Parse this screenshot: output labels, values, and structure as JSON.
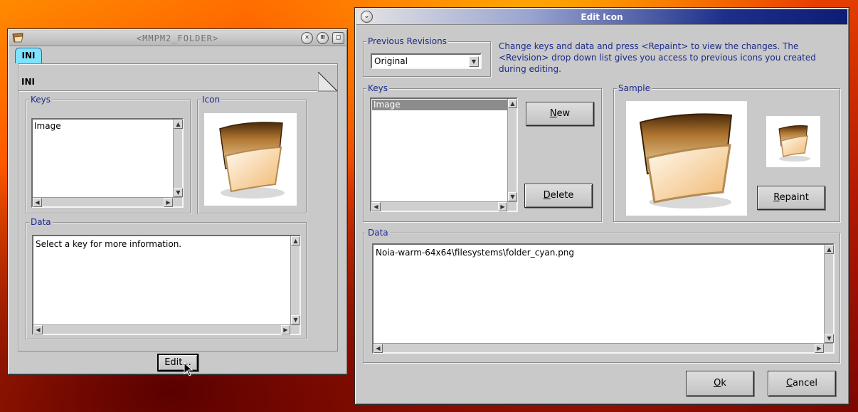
{
  "folder_window": {
    "title": "<MMPM2_FOLDER>",
    "tab_label": "INI",
    "section_label": "INI",
    "keys_group_label": "Keys",
    "keys_items": [
      "Image"
    ],
    "icon_group_label": "Icon",
    "data_group_label": "Data",
    "data_text": "Select a key for more information.",
    "edit_button_label": "Edit..."
  },
  "edit_window": {
    "title": "Edit Icon",
    "revisions_group_label": "Previous Revisions",
    "revision_selected": "Original",
    "help_text": "Change keys and data and press <Repaint> to view the changes. The <Revision> drop down list gives you access to previous icons you created during editing.",
    "keys_group_label": "Keys",
    "keys_items": [
      "Image"
    ],
    "new_button_label_underlined": "N",
    "new_button_label_rest": "ew",
    "delete_button_label_underlined": "D",
    "delete_button_label_rest": "elete",
    "sample_group_label": "Sample",
    "repaint_button_label_underlined": "R",
    "repaint_button_label_rest": "epaint",
    "data_group_label": "Data",
    "data_text": "Noia-warm-64x64\\filesystems\\folder_cyan.png",
    "ok_button_label_underlined": "O",
    "ok_button_label_rest": "k",
    "cancel_button_label_underlined": "C",
    "cancel_button_label_rest": "ancel"
  },
  "colors": {
    "label_blue": "#1c2a8a",
    "title_active": "#0e1d73",
    "tab_cyan": "#7fe3ff",
    "window_gray": "#c9c9c9"
  },
  "icons": {
    "folder_icon": "folder-icon",
    "close": "close-icon",
    "maximize": "maximize-icon",
    "restore": "restore-icon",
    "system_menu": "system-menu-icon"
  }
}
